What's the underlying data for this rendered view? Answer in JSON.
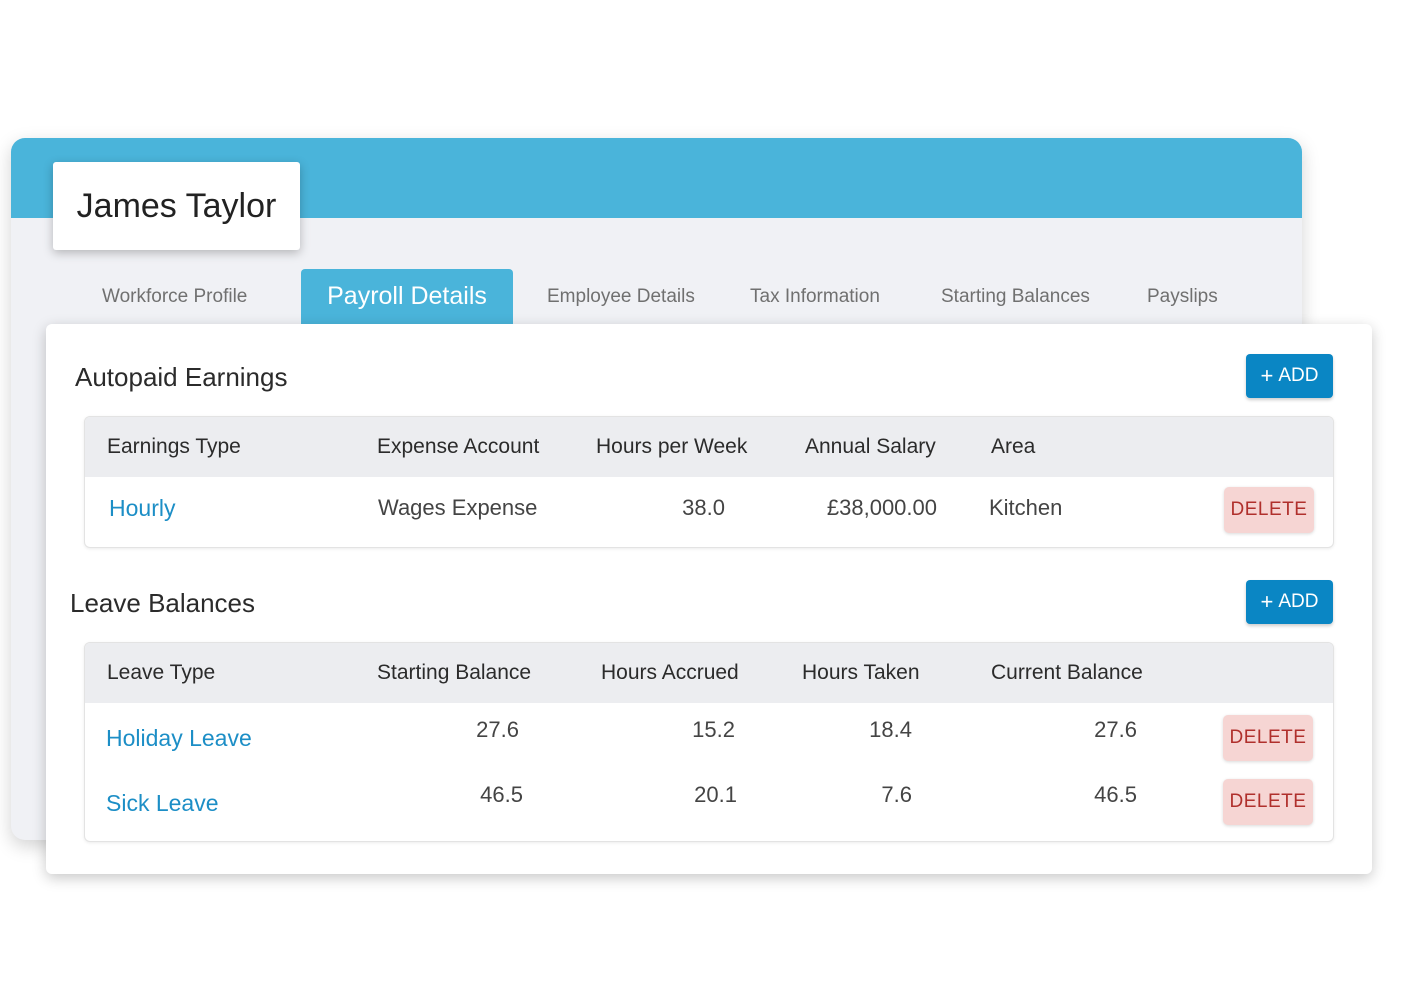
{
  "employee": {
    "name": "James Taylor"
  },
  "tabs": [
    {
      "label": "Workforce Profile",
      "active": false
    },
    {
      "label": "Payroll Details",
      "active": true
    },
    {
      "label": "Employee Details",
      "active": false
    },
    {
      "label": "Tax Information",
      "active": false
    },
    {
      "label": "Starting Balances",
      "active": false
    },
    {
      "label": "Payslips",
      "active": false
    }
  ],
  "earnings": {
    "title": "Autopaid Earnings",
    "add_label": "ADD",
    "columns": [
      "Earnings Type",
      "Expense Account",
      "Hours per Week",
      "Annual Salary",
      "Area"
    ],
    "rows": [
      {
        "type": "Hourly",
        "account": "Wages Expense",
        "hours": "38.0",
        "salary": "£38,000.00",
        "area": "Kitchen",
        "delete_label": "DELETE"
      }
    ]
  },
  "leave": {
    "title": "Leave Balances",
    "add_label": "ADD",
    "columns": [
      "Leave Type",
      "Starting Balance",
      "Hours Accrued",
      "Hours Taken",
      "Current Balance"
    ],
    "rows": [
      {
        "type": "Holiday Leave",
        "starting": "27.6",
        "accrued": "15.2",
        "taken": "18.4",
        "current": "27.6",
        "delete_label": "DELETE"
      },
      {
        "type": "Sick Leave",
        "starting": "46.5",
        "accrued": "20.1",
        "taken": "7.6",
        "current": "46.5",
        "delete_label": "DELETE"
      }
    ]
  },
  "colors": {
    "accent": "#4ab4da",
    "primary_button": "#0a86c4",
    "link": "#1c8ec6",
    "delete_bg": "#f6d5d3",
    "delete_text": "#b0302c"
  }
}
